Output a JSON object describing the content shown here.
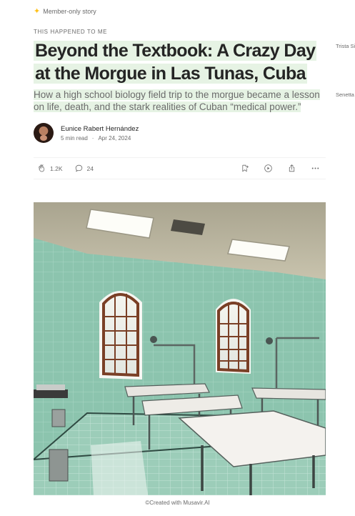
{
  "article": {
    "member_label": "Member-only story",
    "kicker": "THIS HAPPENED TO ME",
    "title": "Beyond the Textbook: A Crazy Day at the Morgue in Las Tunas, Cuba",
    "subtitle": "How a high school biology field trip to the morgue became a lesson on life, death, and the stark realities of Cuban “medical power.”",
    "highlight_color": "#e6f3e4"
  },
  "side_notes": [
    "Trista Si",
    "Senetta"
  ],
  "author": {
    "name": "Eunice Rabert Hernández",
    "read_time": "5 min read",
    "separator": "·",
    "date": "Apr 24, 2024"
  },
  "actions": {
    "claps": "1.2K",
    "responses": "24",
    "icons": [
      "clap-icon",
      "response-icon",
      "bookmark-add-icon",
      "listen-icon",
      "share-icon",
      "more-icon"
    ]
  },
  "hero": {
    "caption": "©Created with Musavir.AI"
  },
  "colors": {
    "accent_star": "#ffc017",
    "text": "#242424",
    "muted": "#6b6b6b"
  }
}
